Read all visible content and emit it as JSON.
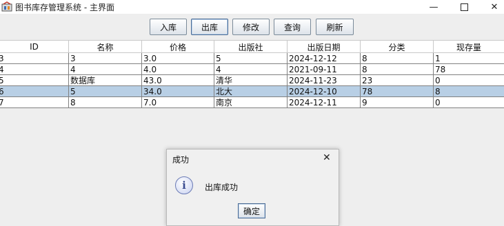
{
  "window": {
    "title": "图书库存管理系统 - 主界面",
    "minimize_glyph": "—",
    "close_glyph": "✕"
  },
  "toolbar": {
    "buttons": [
      {
        "label": "入库"
      },
      {
        "label": "出库"
      },
      {
        "label": "修改"
      },
      {
        "label": "查询"
      },
      {
        "label": "刷新"
      }
    ]
  },
  "table": {
    "columns": [
      "ID",
      "名称",
      "价格",
      "出版社",
      "出版日期",
      "分类",
      "现存量"
    ],
    "rows": [
      [
        "3",
        "3",
        "3.0",
        "5",
        "2024-12-12",
        "8",
        "1"
      ],
      [
        "4",
        "4",
        "4.0",
        "4",
        "2021-09-11",
        "8",
        "78"
      ],
      [
        "5",
        "数据库",
        "43.0",
        "清华",
        "2024-11-23",
        "23",
        "0"
      ],
      [
        "6",
        "5",
        "34.0",
        "北大",
        "2024-12-10",
        "78",
        "8"
      ],
      [
        "7",
        "8",
        "7.0",
        "南京",
        "2024-12-11",
        "9",
        "0"
      ]
    ],
    "selected_row": 3
  },
  "dialog": {
    "title": "成功",
    "message": "出库成功",
    "ok_label": "确定",
    "close_glyph": "✕",
    "info_glyph": "i"
  },
  "colors": {
    "selection": "#b8cfe5",
    "background": "#eeeeee"
  }
}
